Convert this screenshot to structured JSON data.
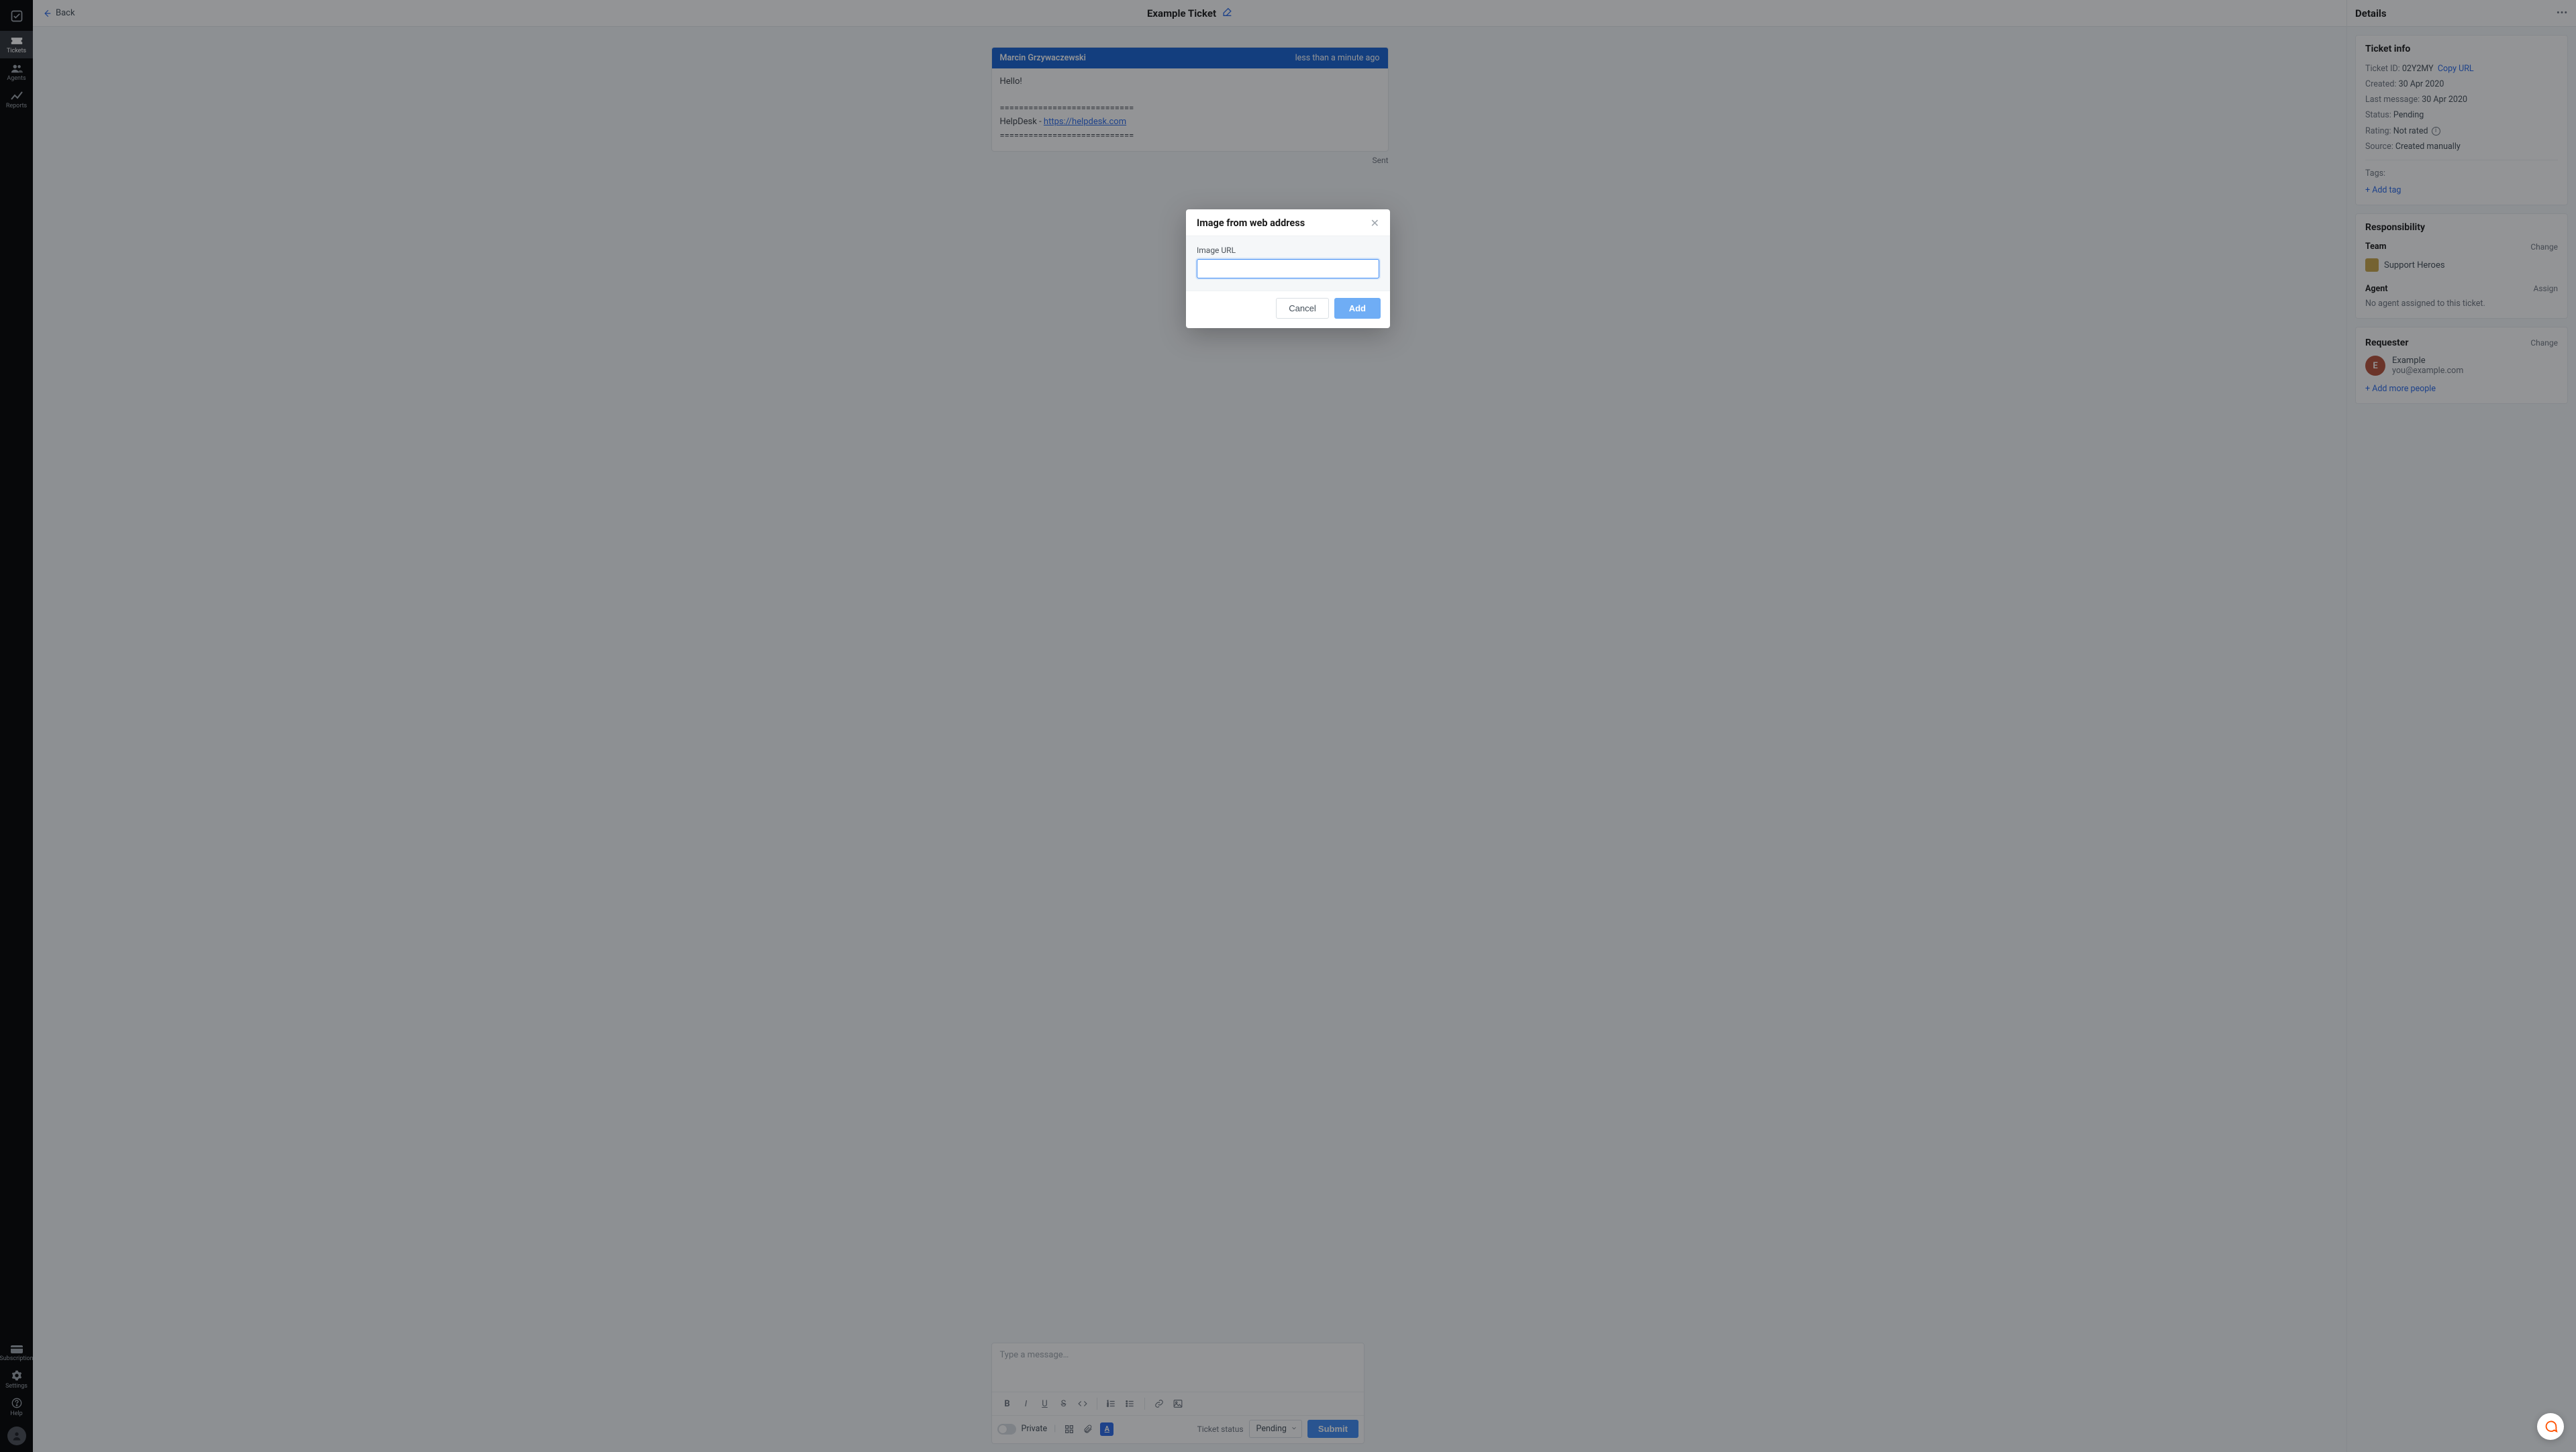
{
  "rail": {
    "nav": [
      {
        "label": "Tickets",
        "icon": "tickets-icon"
      },
      {
        "label": "Agents",
        "icon": "agents-icon"
      },
      {
        "label": "Reports",
        "icon": "reports-icon"
      }
    ],
    "bottom": [
      {
        "label": "Subscription",
        "icon": "subscription-icon"
      },
      {
        "label": "Settings",
        "icon": "settings-icon"
      },
      {
        "label": "Help",
        "icon": "help-icon"
      }
    ]
  },
  "header": {
    "back": "Back",
    "title": "Example Ticket"
  },
  "message": {
    "author": "Marcin Grzywaczewski",
    "time": "less than a minute ago",
    "greeting": "Hello!",
    "sep": "============================",
    "org": "HelpDesk - ",
    "link": "https://helpdesk.com",
    "sent": "Sent"
  },
  "composer": {
    "placeholder": "Type a message…",
    "privateLabel": "Private",
    "cannedLabel": "A",
    "statusLabel": "Ticket status",
    "statusValue": "Pending",
    "submit": "Submit"
  },
  "details": {
    "heading": "Details",
    "ticketInfo": {
      "title": "Ticket info",
      "idLabel": "Ticket ID:",
      "id": "02Y2MY",
      "copy": "Copy URL",
      "createdLabel": "Created:",
      "created": "30 Apr 2020",
      "lastLabel": "Last message:",
      "last": "30 Apr 2020",
      "statusLabel": "Status:",
      "status": "Pending",
      "ratingLabel": "Rating:",
      "rating": "Not rated",
      "sourceLabel": "Source:",
      "source": "Created manually",
      "tagsLabel": "Tags:",
      "addTag": "+ Add tag"
    },
    "responsibility": {
      "title": "Responsibility",
      "teamLabel": "Team",
      "team": "Support Heroes",
      "changeTeam": "Change",
      "agentLabel": "Agent",
      "assign": "Assign",
      "noAgent": "No agent assigned to this ticket."
    },
    "requester": {
      "title": "Requester",
      "change": "Change",
      "initial": "E",
      "name": "Example",
      "email": "you@example.com",
      "addMore": "+ Add more people"
    }
  },
  "modal": {
    "title": "Image from web address",
    "fieldLabel": "Image URL",
    "cancel": "Cancel",
    "add": "Add"
  }
}
